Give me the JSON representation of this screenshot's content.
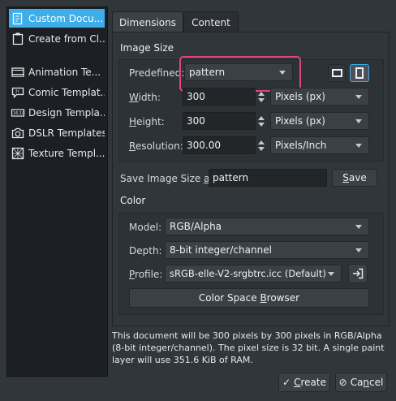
{
  "sidebar": {
    "items": [
      {
        "label": "Custom Docu...",
        "icon": "document-icon"
      },
      {
        "label": "Create from Cl...",
        "icon": "clipboard-icon"
      },
      {
        "label": "Animation Te...",
        "icon": "film-icon"
      },
      {
        "label": "Comic Templat...",
        "icon": "speech-bubble-icon"
      },
      {
        "label": "Design Templa...",
        "icon": "ruler-icon"
      },
      {
        "label": "DSLR Templates",
        "icon": "camera-icon"
      },
      {
        "label": "Texture Templ...",
        "icon": "texture-icon"
      }
    ],
    "selected": 0
  },
  "tabs": [
    {
      "label": "Dimensions",
      "active": true
    },
    {
      "label": "Content",
      "active": false
    }
  ],
  "image_size": {
    "section_title": "Image Size",
    "predefined_label": "Predefined:",
    "predefined_value": "pattern",
    "width_label": "Width:",
    "width_value": "300",
    "width_unit": "Pixels (px)",
    "height_label": "Height:",
    "height_value": "300",
    "height_unit": "Pixels (px)",
    "resolution_label": "Resolution:",
    "resolution_value": "300.00",
    "resolution_unit": "Pixels/Inch",
    "orientation_icons": [
      "landscape-icon",
      "portrait-icon"
    ]
  },
  "save_size": {
    "label": "Save Image Size as:",
    "value": "pattern",
    "button": "Save"
  },
  "color": {
    "section_title": "Color",
    "model_label": "Model:",
    "model_value": "RGB/Alpha",
    "depth_label": "Depth:",
    "depth_value": "8-bit integer/channel",
    "profile_label": "Profile:",
    "profile_value": "sRGB-elle-V2-srgbtrc.icc (Default)",
    "browser_button": "Color Space Browser"
  },
  "info_text": "This document will be 300 pixels by 300 pixels in RGB/Alpha (8-bit integer/channel). The pixel size is 32 bit. A single paint layer will use 351.6 KiB of RAM.",
  "footer": {
    "create": "Create",
    "cancel": "Cancel"
  },
  "colors": {
    "background": "#31363b",
    "selection": "#3daee9",
    "highlight": "#e0457b"
  }
}
